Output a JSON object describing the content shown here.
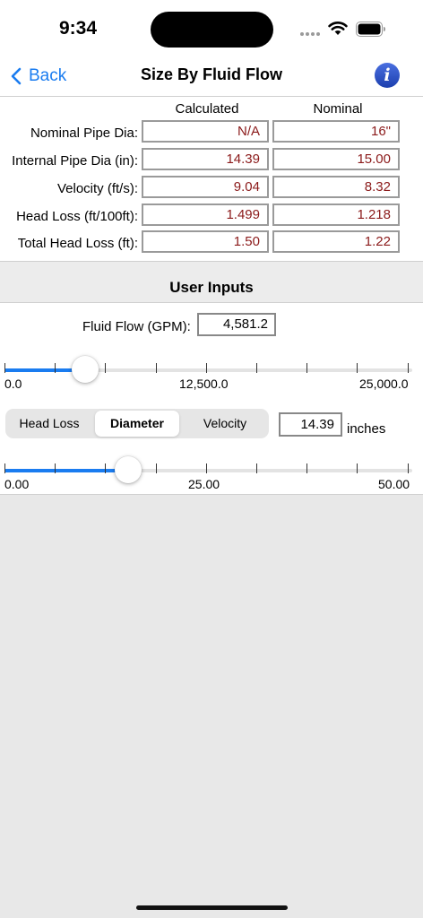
{
  "status": {
    "time": "9:34"
  },
  "nav": {
    "back_label": "Back",
    "title": "Size By Fluid Flow",
    "info_icon": "i"
  },
  "table": {
    "col_calculated": "Calculated",
    "col_nominal": "Nominal",
    "rows": [
      {
        "label": "Nominal Pipe Dia:",
        "calculated": "N/A",
        "nominal": "16\""
      },
      {
        "label": "Internal Pipe Dia (in):",
        "calculated": "14.39",
        "nominal": "15.00"
      },
      {
        "label": "Velocity (ft/s):",
        "calculated": "9.04",
        "nominal": "8.32"
      },
      {
        "label": "Head Loss (ft/100ft):",
        "calculated": "1.499",
        "nominal": "1.218"
      },
      {
        "label": "Total Head Loss (ft):",
        "calculated": "1.50",
        "nominal": "1.22"
      }
    ]
  },
  "inputs": {
    "title": "User Inputs",
    "flow_label": "Fluid Flow (GPM):",
    "flow_value": "4,581.2",
    "flow_slider": {
      "min": 0,
      "max": 25000,
      "value": 4581.2,
      "min_label": "0.0",
      "mid_label": "12,500.0",
      "max_label": "25,000.0"
    },
    "segments": [
      {
        "label": "Head Loss",
        "selected": false
      },
      {
        "label": "Diameter",
        "selected": true
      },
      {
        "label": "Velocity",
        "selected": false
      }
    ],
    "diameter_value": "14.39",
    "diameter_unit": "inches",
    "dia_slider": {
      "min": 0,
      "max": 50,
      "value": 14.39,
      "min_label": "0.00",
      "mid_label": "25.00",
      "max_label": "50.00"
    }
  },
  "colors": {
    "accent": "#1a7cf0",
    "value_text": "#8b1a1a"
  }
}
